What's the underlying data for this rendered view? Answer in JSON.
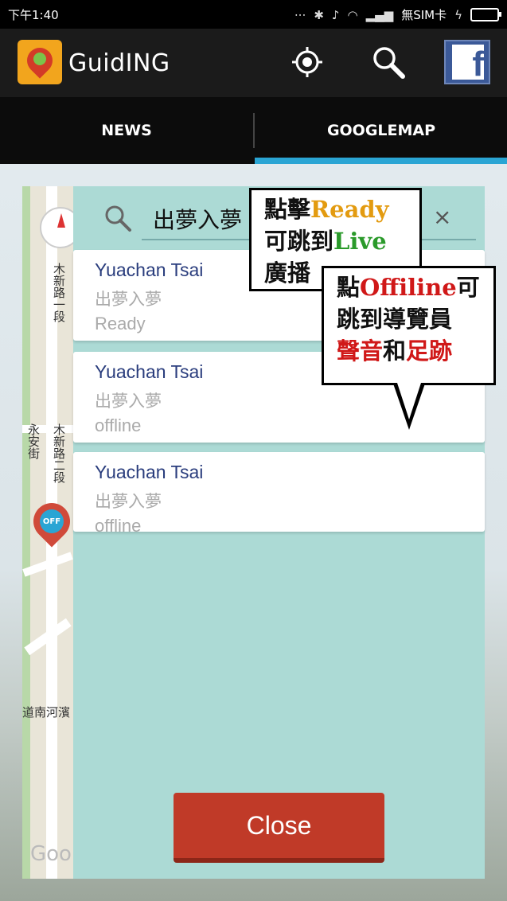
{
  "status_bar": {
    "time": "下午1:40",
    "carrier": "無SIM卡",
    "icons": [
      "signal-dots-icon",
      "bluetooth-icon",
      "mute-icon",
      "wifi-icon",
      "cell-signal-icon",
      "charging-icon",
      "battery-icon"
    ]
  },
  "app_bar": {
    "title": "GuidING",
    "actions": [
      "locate-icon",
      "search-icon",
      "facebook-icon"
    ],
    "facebook_glyph": "f"
  },
  "tabs": [
    {
      "label": "NEWS",
      "selected": false
    },
    {
      "label": "GOOGLEMAP",
      "selected": true
    }
  ],
  "map": {
    "labels": [
      "木新路一段",
      "永安街",
      "木新路二段",
      "道南河濱"
    ],
    "marker_text": "OFF",
    "google_text": "Goo"
  },
  "dialog": {
    "search_value": "出夢入夢",
    "clear_glyph": "×",
    "guides": [
      {
        "name": "Yuachan Tsai",
        "place": "出夢入夢",
        "status": "Ready"
      },
      {
        "name": "Yuachan Tsai",
        "place": " 出夢入夢",
        "status": "offline"
      },
      {
        "name": "Yuachan Tsai",
        "place": " 出夢入夢",
        "status": "offline"
      }
    ],
    "close_label": "Close"
  },
  "callouts": {
    "first": {
      "line1_prefix": "點擊",
      "line1_highlight": "Ready",
      "line2_prefix": "可跳到",
      "line2_highlight": "Live",
      "line3": "廣播"
    },
    "second": {
      "line1_prefix": "點",
      "line1_highlight": "Offiline",
      "line1_suffix": "可",
      "line2": "跳到導覽員",
      "line3_highlight1": "聲音",
      "line3_mid": "和",
      "line3_highlight2": "足跡"
    }
  },
  "colors": {
    "accent": "#2aa5d4",
    "dialog_bg": "#acdad5",
    "close_button": "#c03a28",
    "guide_name": "#2a3d7d",
    "highlight_gold": "#e39b10",
    "highlight_green": "#2a9a2a",
    "highlight_red": "#d01818"
  }
}
